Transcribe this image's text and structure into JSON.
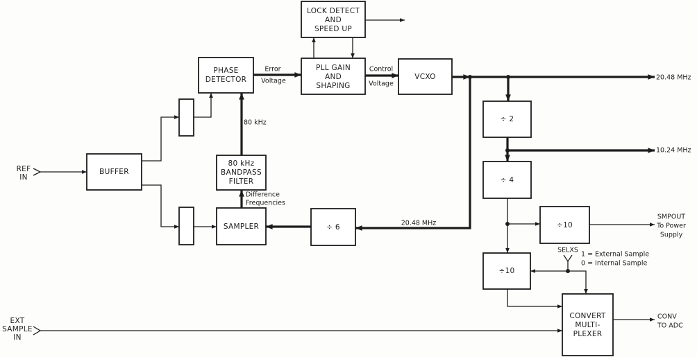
{
  "diagram": {
    "inputs": {
      "ref_in": [
        "REF",
        "IN"
      ],
      "ext_sample_in": [
        "EXT",
        "SAMPLE",
        "IN"
      ]
    },
    "blocks": {
      "buffer": [
        "BUFFER"
      ],
      "phase_detector": [
        "PHASE",
        "DETECTOR"
      ],
      "lock_detect": [
        "LOCK DETECT",
        "AND",
        "SPEED UP"
      ],
      "pll_gain": [
        "PLL GAIN",
        "AND",
        "SHAPING"
      ],
      "vcxo": [
        "VCXO"
      ],
      "bandpass_filter": [
        "80 kHz",
        "BANDPASS",
        "FILTER"
      ],
      "sampler": [
        "SAMPLER"
      ],
      "divide_6": [
        "÷ 6"
      ],
      "divide_2": [
        "÷ 2"
      ],
      "divide_4": [
        "÷ 4"
      ],
      "divide_10_smp": [
        "÷10"
      ],
      "divide_10_conv": [
        "÷10"
      ],
      "convert_mux": [
        "CONVERT",
        "MULTI-",
        "PLEXER"
      ]
    },
    "signals": {
      "error_voltage": [
        "Error",
        "Voltage"
      ],
      "control_voltage": [
        "Control",
        "Voltage"
      ],
      "freq_80khz": "80 kHz",
      "difference_freq": [
        "Difference",
        "Frequencies"
      ],
      "feedback_freq": "20.48 MHz",
      "out_20_48": "20.48 MHz",
      "out_10_24": "10.24 MHz",
      "smpout": [
        "SMPOUT",
        "To Power",
        "Supply"
      ],
      "conv": [
        "CONV",
        "TO ADC"
      ],
      "selxs": "SELXS",
      "selxs_legend": [
        "1 = External Sample",
        "0 = Internal Sample"
      ]
    }
  }
}
